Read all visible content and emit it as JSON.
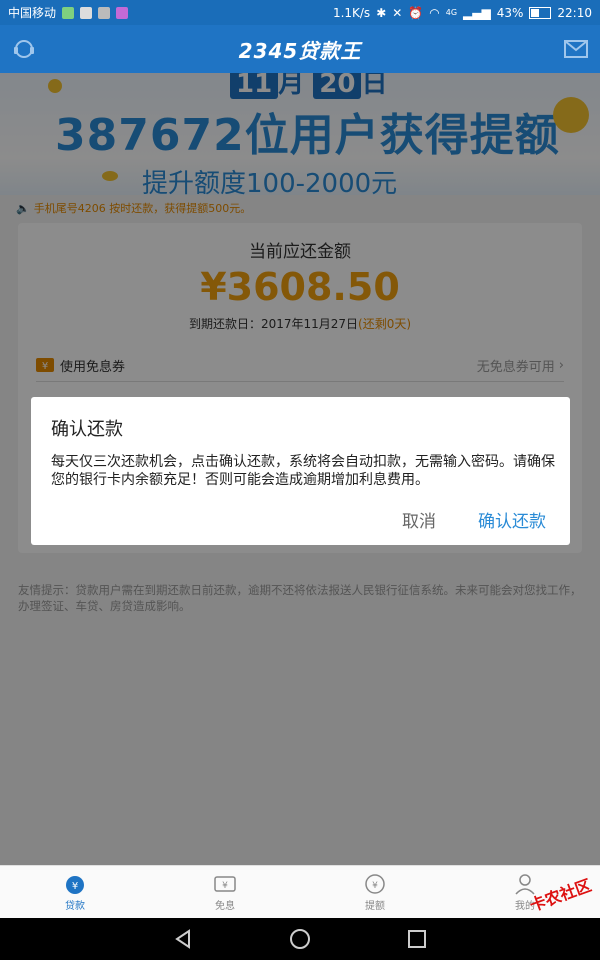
{
  "status_bar": {
    "carrier": "中国移动",
    "speed": "1.1K/s",
    "network": "4G",
    "battery": "43%",
    "battery_level": 0.43,
    "time": "22:10"
  },
  "header": {
    "title": "2345贷款王",
    "left_icon": "customer-service-icon",
    "right_icon": "mail-icon"
  },
  "banner": {
    "date_month": "11",
    "date_month_unit": "月",
    "date_day": "20",
    "date_day_unit": "日",
    "headline": "387672位用户获得提额",
    "subline": "提升额度100-2000元"
  },
  "notice": {
    "text": "手机尾号4206 按时还款，获得提额500元。",
    "icon": "speaker-icon"
  },
  "repayment": {
    "label": "当前应还金额",
    "amount": "¥3608.50",
    "due_prefix": "到期还款日：2017年11月27日",
    "due_remaining": "(还剩0天)",
    "coupon_label": "使用免息券",
    "coupon_status": "无免息券可用"
  },
  "tip": "友情提示：贷款用户需在到期还款日前还款，逾期不还将依法报送人民银行征信系统。未来可能会对您找工作，办理签证、车贷、房贷造成影响。",
  "dialog": {
    "title": "确认还款",
    "body": "每天仅三次还款机会，点击确认还款，系统将会自动扣款，无需输入密码。请确保您的银行卡内余额充足！否则可能会造成逾期增加利息费用。",
    "cancel": "取消",
    "confirm": "确认还款"
  },
  "tabs": [
    {
      "label": "贷款",
      "icon": "loan-icon",
      "active": true
    },
    {
      "label": "免息",
      "icon": "interest-free-icon",
      "active": false
    },
    {
      "label": "提额",
      "icon": "credit-increase-icon",
      "active": false
    },
    {
      "label": "我的",
      "icon": "profile-icon",
      "active": false
    }
  ],
  "watermark": "卡农社区",
  "colors": {
    "primary": "#1f74c4",
    "amount": "#f0a010",
    "notice": "#e58a00",
    "link": "#2a8bd6"
  }
}
